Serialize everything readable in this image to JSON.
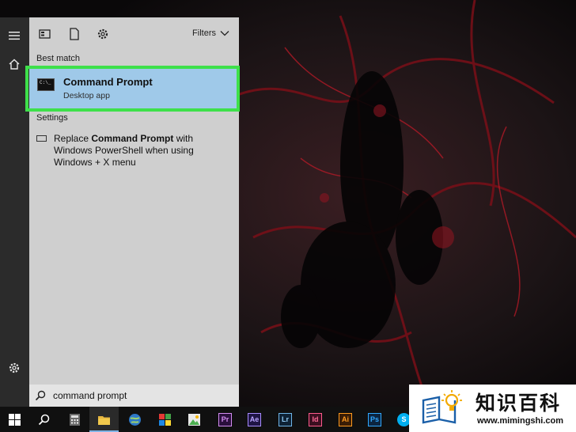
{
  "start_menu": {
    "filters_label": "Filters",
    "best_match_heading": "Best match",
    "best_match": {
      "title": "Command Prompt",
      "subtitle": "Desktop app",
      "icon_text": "C:\\_"
    },
    "settings_heading": "Settings",
    "settings_item": {
      "part1": "Replace ",
      "bold": "Command Prompt",
      "part2": " with Windows PowerShell when using Windows + X menu"
    },
    "search_value": "command prompt"
  },
  "taskbar": {
    "icons": [
      "windows-icon",
      "search-icon",
      "calculator-icon",
      "file-explorer-icon",
      "browser-icon",
      "store-icon",
      "photo-app-icon",
      "premiere-icon",
      "after-effects-icon",
      "lightroom-icon",
      "indesign-icon",
      "illustrator-icon",
      "photoshop-icon",
      "skype-icon"
    ],
    "app_labels": {
      "pr": "Pr",
      "ae": "Ae",
      "lr": "Lr",
      "id": "Id",
      "ai": "Ai",
      "ps": "Ps",
      "s": "S"
    }
  },
  "watermark": {
    "title": "知识百科",
    "url": "www.mimingshi.com"
  },
  "colors": {
    "highlight": "#3ee04a",
    "best_match_bg": "#9fc9e9",
    "panel_bg": "#cfcfcf"
  }
}
